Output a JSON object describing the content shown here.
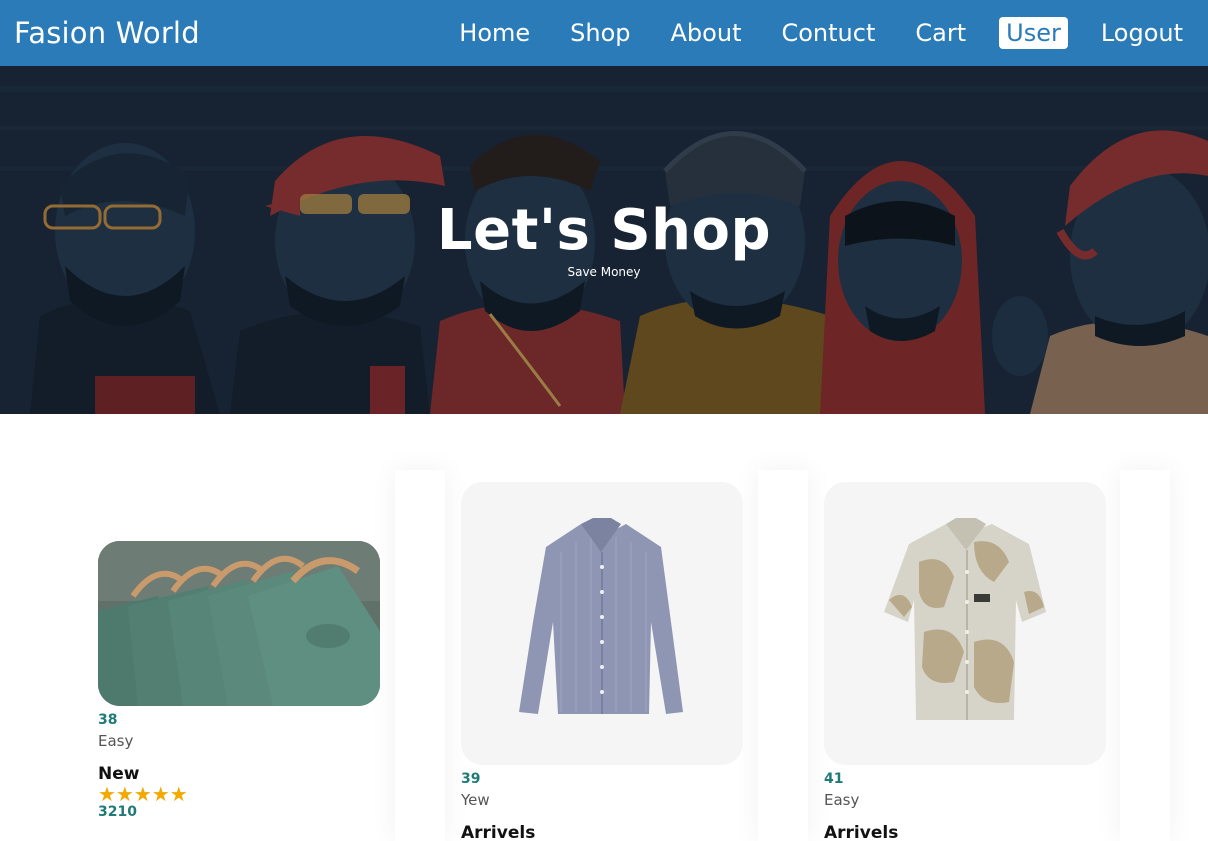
{
  "navbar": {
    "brand": "Fasion World",
    "items": [
      {
        "label": "Home",
        "active": false
      },
      {
        "label": "Shop",
        "active": false
      },
      {
        "label": "About",
        "active": false
      },
      {
        "label": "Contuct",
        "active": false
      },
      {
        "label": "Cart",
        "active": false
      },
      {
        "label": "User",
        "active": true
      },
      {
        "label": "Logout",
        "active": false
      }
    ]
  },
  "hero": {
    "title": "Let's Shop",
    "subtitle": "Save Money"
  },
  "products": [
    {
      "image": "green-tshirts-on-hangers",
      "price": "38",
      "desc": "Easy",
      "name": "New",
      "stars": "★★★★★",
      "count": "3210"
    },
    {
      "image": "blue-checked-shirt",
      "price": "39",
      "desc": "Yew",
      "name": "Arrivels"
    },
    {
      "image": "printed-short-sleeve-shirt",
      "price": "41",
      "desc": "Easy",
      "name": "Arrivels"
    }
  ],
  "colors": {
    "navbar": "#2b7bb9",
    "accent_text": "#1f7a78",
    "star": "#f2a900"
  }
}
